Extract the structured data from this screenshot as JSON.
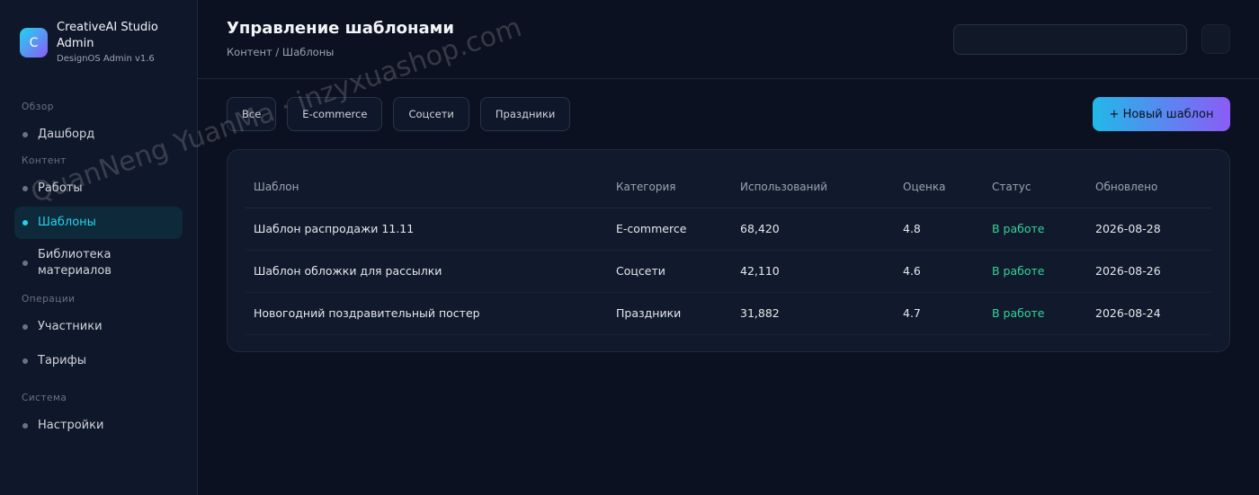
{
  "brand": {
    "logo_letter": "C",
    "name": "CreativeAI Studio Admin",
    "version": "DesignOS Admin v1.6"
  },
  "sidebar": {
    "sections": [
      {
        "title": "Обзор",
        "items": [
          {
            "label": "Дашборд",
            "active": false
          }
        ]
      },
      {
        "title": "Контент",
        "items": [
          {
            "label": "Работы",
            "active": false
          },
          {
            "label": "Шаблоны",
            "active": true
          },
          {
            "label": "Библиотека материалов",
            "active": false
          }
        ]
      },
      {
        "title": "Операции",
        "items": [
          {
            "label": "Участники",
            "active": false
          },
          {
            "label": "Тарифы",
            "active": false
          }
        ]
      },
      {
        "title": "Система",
        "items": [
          {
            "label": "Настройки",
            "active": false
          }
        ]
      }
    ]
  },
  "header": {
    "title": "Управление шаблонами",
    "breadcrumb": "Контент / Шаблоны",
    "search_placeholder": ""
  },
  "filters": [
    "Все",
    "E-commerce",
    "Соцсети",
    "Праздники"
  ],
  "new_button_label": "+ Новый шаблон",
  "table": {
    "columns": [
      "Шаблон",
      "Категория",
      "Использований",
      "Оценка",
      "Статус",
      "Обновлено"
    ],
    "rows": [
      [
        "Шаблон распродажи 11.11",
        "E-commerce",
        "68,420",
        "4.8",
        "В работе",
        "2026-08-28"
      ],
      [
        "Шаблон обложки для рассылки",
        "Соцсети",
        "42,110",
        "4.6",
        "В работе",
        "2026-08-26"
      ],
      [
        "Новогодний поздравительный постер",
        "Праздники",
        "31,882",
        "4.7",
        "В работе",
        "2026-08-24"
      ]
    ]
  },
  "watermark": "QuanNeng YuanMa · inzyxuashop.com",
  "colors": {
    "accent": "#22d3ee",
    "accent_secondary": "#8b5cf6",
    "status_active": "#34d399",
    "background": "#0b1120"
  }
}
